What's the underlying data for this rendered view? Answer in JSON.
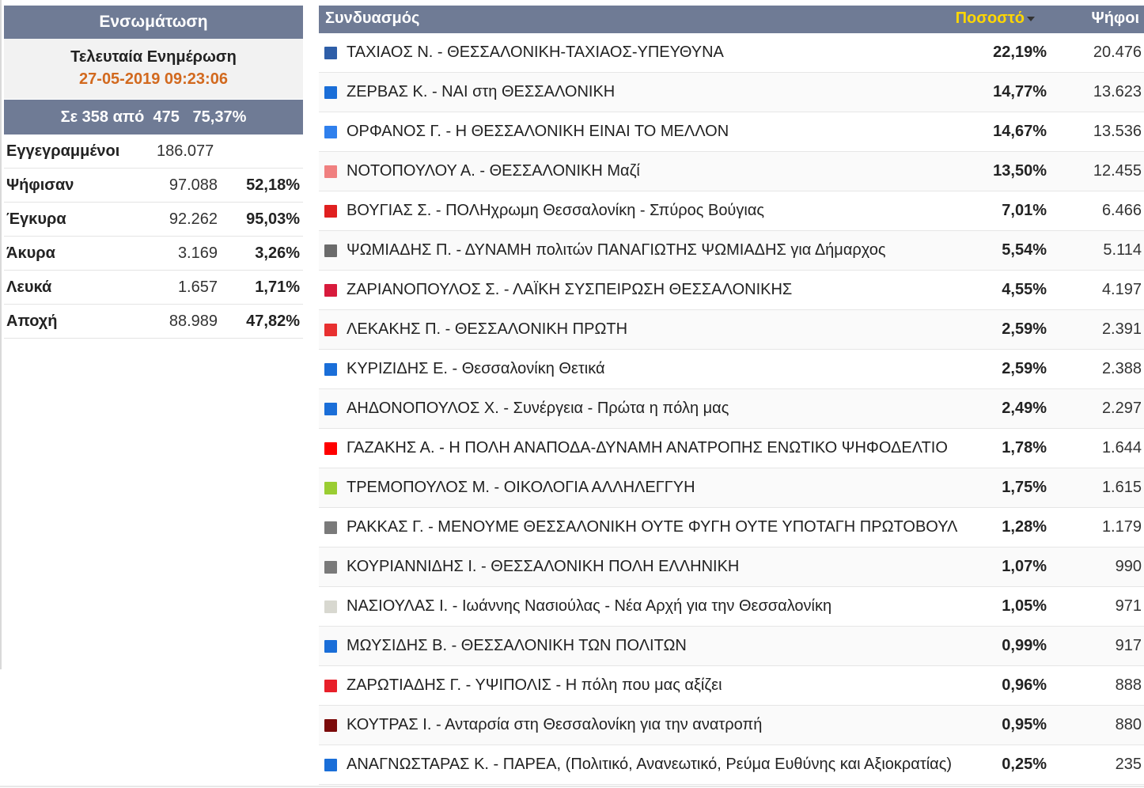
{
  "summary": {
    "title": "Ενσωμάτωση",
    "update_label": "Τελευταία Ενημέρωση",
    "update_time": "27-05-2019 09:23:06",
    "progress": "Σε 358 από  475   75,37%",
    "stats": [
      {
        "label": "Εγγεγραμμένοι",
        "value": "186.077",
        "pct": ""
      },
      {
        "label": "Ψήφισαν",
        "value": "97.088",
        "pct": "52,18%"
      },
      {
        "label": "Έγκυρα",
        "value": "92.262",
        "pct": "95,03%"
      },
      {
        "label": "Άκυρα",
        "value": "3.169",
        "pct": "3,26%"
      },
      {
        "label": "Λευκά",
        "value": "1.657",
        "pct": "1,71%"
      },
      {
        "label": "Αποχή",
        "value": "88.989",
        "pct": "47,82%"
      }
    ]
  },
  "results": {
    "header": {
      "party": "Συνδυασμός",
      "pct": "Ποσοστό",
      "votes": "Ψήφοι"
    },
    "rows": [
      {
        "name": "ΤΑΧΙΑΟΣ Ν. - ΘΕΣΣΑΛΟΝΙΚΗ-ΤΑΧΙΑΟΣ-ΥΠΕΥΘΥΝΑ",
        "pct": "22,19%",
        "votes": "20.476",
        "color": "#2e5ea8"
      },
      {
        "name": "ΖΕΡΒΑΣ Κ. - ΝΑΙ στη ΘΕΣΣΑΛΟΝΙΚΗ",
        "pct": "14,77%",
        "votes": "13.623",
        "color": "#1a6ed8"
      },
      {
        "name": "ΟΡΦΑΝΟΣ Γ. - Η ΘΕΣΣΑΛΟΝΙΚΗ ΕΙΝΑΙ ΤΟ ΜΕΛΛΟΝ",
        "pct": "14,67%",
        "votes": "13.536",
        "color": "#2f80ed"
      },
      {
        "name": "ΝΟΤΟΠΟΥΛΟΥ Α. - ΘΕΣΣΑΛΟΝΙΚΗ Μαζί",
        "pct": "13,50%",
        "votes": "12.455",
        "color": "#f08080"
      },
      {
        "name": "ΒΟΥΓΙΑΣ Σ. - ΠΟΛΗχρωμη Θεσσαλονίκη - Σπύρος Βούγιας",
        "pct": "7,01%",
        "votes": "6.466",
        "color": "#e02020"
      },
      {
        "name": "ΨΩΜΙΑΔΗΣ Π. - ΔΥΝΑΜΗ πολιτών ΠΑΝΑΓΙΩΤΗΣ ΨΩΜΙΑΔΗΣ για Δήμαρχος",
        "pct": "5,54%",
        "votes": "5.114",
        "color": "#6b6b6b"
      },
      {
        "name": "ΖΑΡΙΑΝΟΠΟΥΛΟΣ Σ. - ΛΑΪΚΗ ΣΥΣΠΕΙΡΩΣΗ ΘΕΣΣΑΛΟΝΙΚΗΣ",
        "pct": "4,55%",
        "votes": "4.197",
        "color": "#d81b3c"
      },
      {
        "name": "ΛΕΚΑΚΗΣ Π. - ΘΕΣΣΑΛΟΝΙΚΗ ΠΡΩΤΗ",
        "pct": "2,59%",
        "votes": "2.391",
        "color": "#e83030"
      },
      {
        "name": "ΚΥΡΙΖΙΔΗΣ Ε. - Θεσσαλονίκη Θετικά",
        "pct": "2,59%",
        "votes": "2.388",
        "color": "#1a6ed8"
      },
      {
        "name": "ΑΗΔΟΝΟΠΟΥΛΟΣ Χ. - Συνέργεια - Πρώτα η πόλη μας",
        "pct": "2,49%",
        "votes": "2.297",
        "color": "#1a6ed8"
      },
      {
        "name": "ΓΑΖΑΚΗΣ Α. - Η ΠΟΛΗ ΑΝΑΠΟΔΑ-ΔΥΝΑΜΗ ΑΝΑΤΡΟΠΗΣ ΕΝΩΤΙΚΟ ΨΗΦΟΔΕΛΤΙΟ",
        "pct": "1,78%",
        "votes": "1.644",
        "color": "#ff0000"
      },
      {
        "name": "ΤΡΕΜΟΠΟΥΛΟΣ Μ. - ΟΙΚΟΛΟΓΙΑ ΑΛΛΗΛΕΓΓΥΗ",
        "pct": "1,75%",
        "votes": "1.615",
        "color": "#9acd32"
      },
      {
        "name": "ΡΑΚΚΑΣ Γ. - ΜΕΝΟΥΜΕ ΘΕΣΣΑΛΟΝΙΚΗ ΟΥΤΕ ΦΥΓΗ ΟΥΤΕ ΥΠΟΤΑΓΗ ΠΡΩΤΟΒΟΥΛ",
        "pct": "1,28%",
        "votes": "1.179",
        "color": "#7a7a7a"
      },
      {
        "name": "ΚΟΥΡΙΑΝΝΙΔΗΣ Ι. - ΘΕΣΣΑΛΟΝΙΚΗ ΠΟΛΗ ΕΛΛΗΝΙΚΗ",
        "pct": "1,07%",
        "votes": "990",
        "color": "#7a7a7a"
      },
      {
        "name": "ΝΑΣΙΟΥΛΑΣ Ι. - Ιωάννης Νασιούλας - Νέα Αρχή για την Θεσσαλονίκη",
        "pct": "1,05%",
        "votes": "971",
        "color": "#d8d8d0"
      },
      {
        "name": "ΜΩΥΣΙΔΗΣ Β. - ΘΕΣΣΑΛΟΝΙΚΗ ΤΩΝ ΠΟΛΙΤΩΝ",
        "pct": "0,99%",
        "votes": "917",
        "color": "#1a6ed8"
      },
      {
        "name": "ΖΑΡΩΤΙΑΔΗΣ Γ. - ΥΨΙΠΟΛΙΣ - Η πόλη που μας αξίζει",
        "pct": "0,96%",
        "votes": "888",
        "color": "#e8202a"
      },
      {
        "name": "ΚΟΥΤΡΑΣ Ι. - Ανταρσία στη Θεσσαλονίκη για την ανατροπή",
        "pct": "0,95%",
        "votes": "880",
        "color": "#7b0a0a"
      },
      {
        "name": "ΑΝΑΓΝΩΣΤΑΡΑΣ Κ. - ΠΑΡΕΑ, (Πολιτικό, Ανανεωτικό, Ρεύμα Ευθύνης και Αξιοκρατίας)",
        "pct": "0,25%",
        "votes": "235",
        "color": "#1a6ed8"
      }
    ]
  }
}
